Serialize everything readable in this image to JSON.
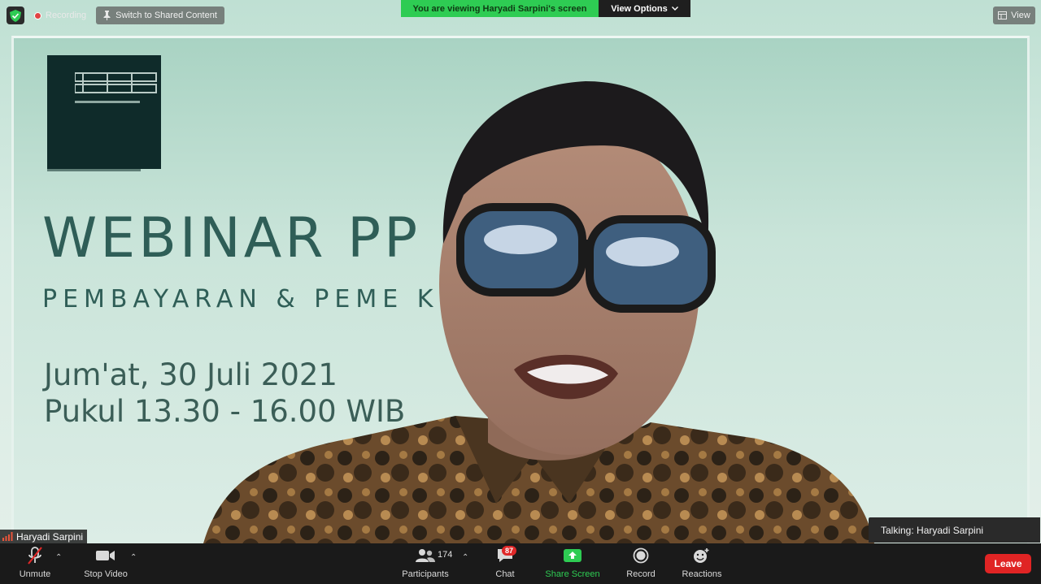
{
  "top_bar": {
    "recording_label": "Recording",
    "switch_label": "Switch to Shared Content",
    "viewing_text": "You are viewing Haryadi Sarpini's screen",
    "view_options_label": "View Options",
    "view_label": "View"
  },
  "slide": {
    "title": "WEBINAR PP",
    "subtitle": "PEMBAYARAN & PEME            K EKSPOR",
    "date": "Jum'at, 30 Juli 2021",
    "time": "Pukul 13.30 - 16.00 WIB"
  },
  "video": {
    "participant_name": "Haryadi Sarpini",
    "talking_label": "Talking: Haryadi Sarpini"
  },
  "toolbar": {
    "unmute_label": "Unmute",
    "stop_video_label": "Stop Video",
    "participants_label": "Participants",
    "participants_count": "174",
    "chat_label": "Chat",
    "chat_badge": "87",
    "share_label": "Share Screen",
    "record_label": "Record",
    "reactions_label": "Reactions",
    "leave_label": "Leave"
  },
  "colors": {
    "accent_green": "#2ecc53",
    "leave_red": "#e02424",
    "toolbar_bg": "#1a1a1a",
    "slide_text": "#2f5e57"
  }
}
